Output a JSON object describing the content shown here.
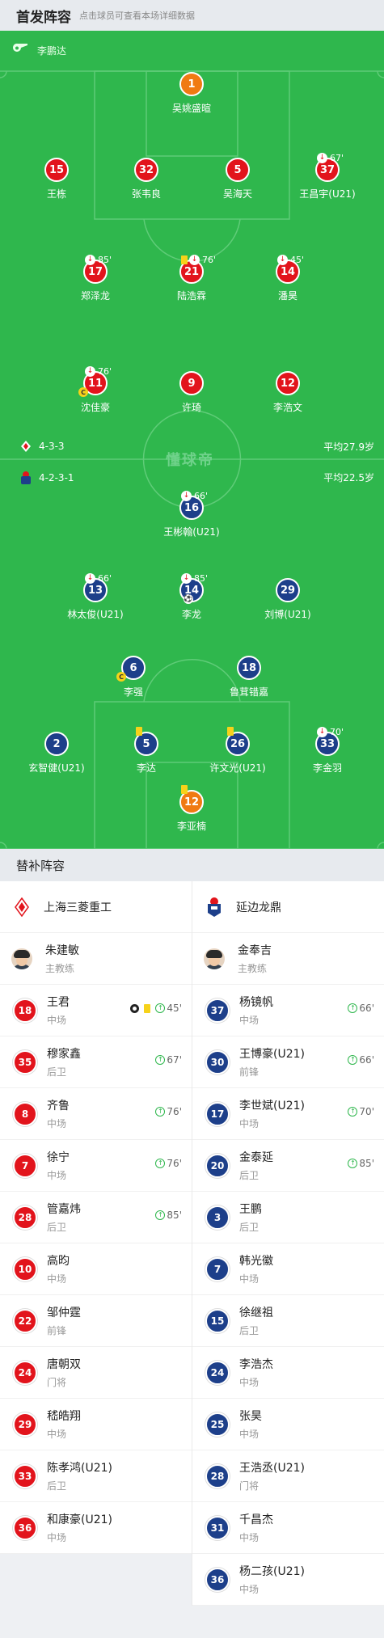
{
  "header": {
    "title": "首发阵容",
    "subtitle": "点击球员可查看本场详细数据"
  },
  "referee": "李鹏达",
  "watermark": "懂球帝",
  "colors": {
    "pitch": "#2fb74d",
    "home": "#e2141c",
    "away": "#1d3f8a",
    "goalkeeper": "#f07a12",
    "yellow_card": "#f6d21a"
  },
  "home_formation": {
    "formation": "4-3-3",
    "avg_age": "平均27.9岁"
  },
  "away_formation": {
    "formation": "4-2-3-1",
    "avg_age": "平均22.5岁"
  },
  "home_lineup": [
    {
      "num": "1",
      "name": "吴姚盛暄",
      "kit": "orange"
    },
    {
      "num": "15",
      "name": "王栋",
      "kit": "red"
    },
    {
      "num": "32",
      "name": "张韦良",
      "kit": "red"
    },
    {
      "num": "5",
      "name": "吴海天",
      "kit": "red"
    },
    {
      "num": "37",
      "name": "王昌宇(U21)",
      "kit": "red",
      "sub_min": "67'"
    },
    {
      "num": "17",
      "name": "郑泽龙",
      "kit": "red",
      "sub_min": "85'"
    },
    {
      "num": "21",
      "name": "陆浩霖",
      "kit": "red",
      "sub_min": "76'",
      "yellow": true
    },
    {
      "num": "14",
      "name": "潘昊",
      "kit": "red",
      "sub_min": "45'"
    },
    {
      "num": "11",
      "name": "沈佳豪",
      "kit": "red",
      "sub_min": "76'",
      "captain": "C"
    },
    {
      "num": "9",
      "name": "许琦",
      "kit": "red"
    },
    {
      "num": "12",
      "name": "李浩文",
      "kit": "red"
    }
  ],
  "away_lineup": [
    {
      "num": "16",
      "name": "王彬翰(U21)",
      "kit": "blue",
      "sub_min": "66'"
    },
    {
      "num": "13",
      "name": "林太俊(U21)",
      "kit": "blue",
      "sub_min": "66'"
    },
    {
      "num": "14",
      "name": "李龙",
      "kit": "blue",
      "sub_min": "85'",
      "goal": true
    },
    {
      "num": "29",
      "name": "刘博(U21)",
      "kit": "blue"
    },
    {
      "num": "6",
      "name": "李强",
      "kit": "blue",
      "captain": "C"
    },
    {
      "num": "18",
      "name": "鲁茸错嘉",
      "kit": "blue"
    },
    {
      "num": "2",
      "name": "玄智健(U21)",
      "kit": "blue"
    },
    {
      "num": "5",
      "name": "李达",
      "kit": "blue",
      "yellow": true
    },
    {
      "num": "26",
      "name": "许文光(U21)",
      "kit": "blue",
      "yellow": true
    },
    {
      "num": "33",
      "name": "李金羽",
      "kit": "blue",
      "sub_min": "70'"
    },
    {
      "num": "12",
      "name": "李亚楠",
      "kit": "orange",
      "yellow": true
    }
  ],
  "subs_title": "替补阵容",
  "home_team": {
    "name": "上海三菱重工",
    "coach": "朱建敏",
    "coach_role": "主教练"
  },
  "away_team": {
    "name": "延边龙鼎",
    "coach": "金奉吉",
    "coach_role": "主教练"
  },
  "home_subs": [
    {
      "num": "18",
      "name": "王君",
      "pos": "中场",
      "in_min": "45'",
      "goal": true,
      "yellow": true
    },
    {
      "num": "35",
      "name": "穆家鑫",
      "pos": "后卫",
      "in_min": "67'"
    },
    {
      "num": "8",
      "name": "齐鲁",
      "pos": "中场",
      "in_min": "76'"
    },
    {
      "num": "7",
      "name": "徐宁",
      "pos": "中场",
      "in_min": "76'"
    },
    {
      "num": "28",
      "name": "管嘉炜",
      "pos": "后卫",
      "in_min": "85'"
    },
    {
      "num": "10",
      "name": "高昀",
      "pos": "中场"
    },
    {
      "num": "22",
      "name": "邹仲霆",
      "pos": "前锋"
    },
    {
      "num": "24",
      "name": "唐朝双",
      "pos": "门将"
    },
    {
      "num": "29",
      "name": "嵇皓翔",
      "pos": "中场"
    },
    {
      "num": "33",
      "name": "陈孝鸿(U21)",
      "pos": "后卫"
    },
    {
      "num": "36",
      "name": "和康豪(U21)",
      "pos": "中场"
    }
  ],
  "away_subs": [
    {
      "num": "37",
      "name": "杨镜帆",
      "pos": "中场",
      "in_min": "66'"
    },
    {
      "num": "30",
      "name": "王博豪(U21)",
      "pos": "前锋",
      "in_min": "66'"
    },
    {
      "num": "17",
      "name": "李世斌(U21)",
      "pos": "中场",
      "in_min": "70'"
    },
    {
      "num": "20",
      "name": "金泰延",
      "pos": "后卫",
      "in_min": "85'"
    },
    {
      "num": "3",
      "name": "王鹏",
      "pos": "后卫"
    },
    {
      "num": "7",
      "name": "韩光徽",
      "pos": "中场"
    },
    {
      "num": "15",
      "name": "徐继祖",
      "pos": "后卫"
    },
    {
      "num": "24",
      "name": "李浩杰",
      "pos": "中场"
    },
    {
      "num": "25",
      "name": "张昊",
      "pos": "中场"
    },
    {
      "num": "28",
      "name": "王浩丞(U21)",
      "pos": "门将"
    },
    {
      "num": "31",
      "name": "千昌杰",
      "pos": "中场"
    },
    {
      "num": "36",
      "name": "杨二孩(U21)",
      "pos": "中场"
    }
  ]
}
